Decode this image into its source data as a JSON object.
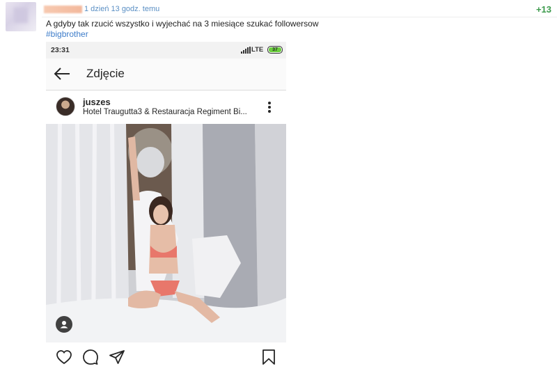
{
  "entry": {
    "timestamp": "1 dzień 13 godz. temu",
    "vote_count": "+13",
    "body_text": "A gdyby tak rzucić wszystko i wyjechać na 3 miesiące szukać followersow",
    "hashtag": "#bigbrother"
  },
  "phone": {
    "status_time": "23:31",
    "network_label": "LTE",
    "battery_level": "37",
    "battery_color": "#6bcf3e",
    "screen_title": "Zdjęcie"
  },
  "instagram_post": {
    "username": "juszes",
    "location": "Hotel Traugutta3 & Restauracja Regiment Bi...",
    "icons": [
      "back-arrow-icon",
      "more-options-icon",
      "user-tag-icon",
      "heart-icon",
      "comment-icon",
      "share-icon",
      "bookmark-icon"
    ]
  },
  "colors": {
    "timestamp_link": "#5a8fc4",
    "vote_positive": "#3c9a4c",
    "hashtag_link": "#3d7cc9"
  }
}
